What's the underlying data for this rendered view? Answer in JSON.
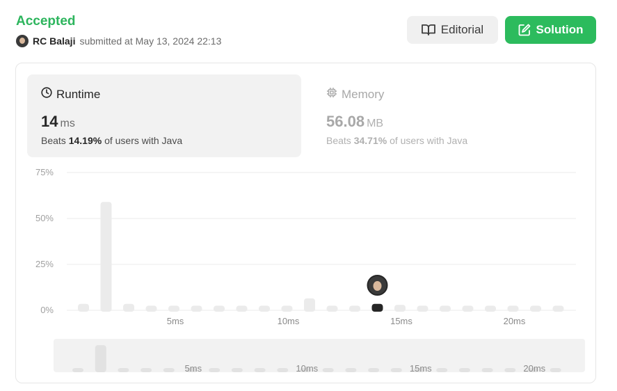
{
  "header": {
    "status": "Accepted",
    "username": "RC Balaji",
    "submitted_text": "submitted at May 13, 2024 22:13",
    "editorial_label": "Editorial",
    "solution_label": "Solution"
  },
  "runtime": {
    "title": "Runtime",
    "value": "14",
    "unit": "ms",
    "beats_prefix": "Beats",
    "beats_pct": "14.19%",
    "beats_suffix": "of users with Java"
  },
  "memory": {
    "title": "Memory",
    "value": "56.08",
    "unit": "MB",
    "beats_prefix": "Beats",
    "beats_pct": "34.71%",
    "beats_suffix": "of users with Java"
  },
  "colors": {
    "accepted": "#2db55d",
    "solution_button": "#2cbb5d",
    "bar": "#ebebeb",
    "user_bar": "#262626"
  },
  "chart_data": {
    "type": "bar",
    "x": [
      1,
      2,
      3,
      4,
      5,
      6,
      7,
      8,
      9,
      10,
      11,
      12,
      13,
      14,
      15,
      16,
      17,
      18,
      19,
      20,
      21,
      22
    ],
    "values": [
      3.5,
      59,
      3.5,
      2.5,
      2.5,
      2.5,
      2.5,
      2.5,
      2.5,
      2.5,
      6.5,
      2.5,
      2.5,
      3.5,
      3,
      2.5,
      2.5,
      2.5,
      2.5,
      2.5,
      2.5,
      2.5
    ],
    "highlight_x": 14,
    "y_ticks": [
      "0%",
      "25%",
      "50%",
      "75%"
    ],
    "y_tick_values": [
      0,
      25,
      50,
      75
    ],
    "x_ticks": [
      "5ms",
      "10ms",
      "15ms",
      "20ms"
    ],
    "x_tick_values": [
      5,
      10,
      15,
      20
    ],
    "ylim": [
      0,
      75
    ],
    "grid": true
  }
}
